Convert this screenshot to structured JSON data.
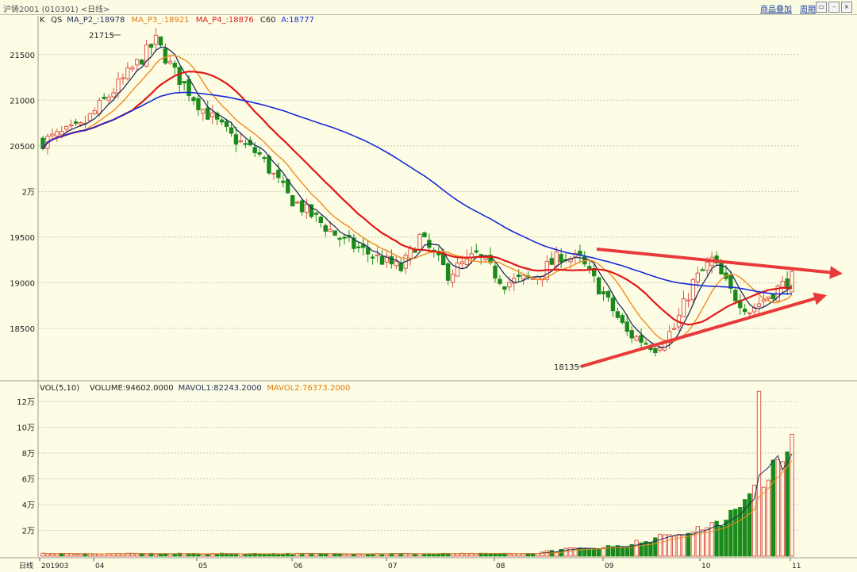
{
  "window": {
    "title": "沪铸2001 (010301) <日线>",
    "links": [
      "商品叠加",
      "周期"
    ]
  },
  "colors": {
    "background": "#fdfde6",
    "up": "#e0554f",
    "down": "#1b8a1b",
    "ma2": "#1e2f5a",
    "ma3": "#f08a1c",
    "ma4": "#e01818",
    "ma60": "#1a28d6",
    "arrow": "#e83a3a"
  },
  "price_panel": {
    "legend": [
      {
        "text": "K",
        "color": "#222222"
      },
      {
        "text": "QS",
        "color": "#222222"
      },
      {
        "text": "MA_P2_:18978",
        "color": "#1e2f5a"
      },
      {
        "text": "MA_P3_:18921",
        "color": "#e07a10"
      },
      {
        "text": "MA_P4_:18876",
        "color": "#e01818"
      },
      {
        "text": "C60",
        "color": "#222222"
      },
      {
        "text": "A:18777",
        "color": "#1a28d6"
      }
    ],
    "y_labels": [
      "21500",
      "21000",
      "20500",
      "2万",
      "19500",
      "19000",
      "18500"
    ],
    "high_label": "21715",
    "low_label": "18135"
  },
  "volume_panel": {
    "legend": [
      {
        "text": "VOL(5,10)",
        "color": "#222222"
      },
      {
        "text": "VOLUME:94602.0000",
        "color": "#222222"
      },
      {
        "text": "MAVOL1:82243.2000",
        "color": "#1e2f5a"
      },
      {
        "text": "MAVOL2:76373.2000",
        "color": "#e07a10"
      }
    ],
    "y_labels": [
      "12万",
      "10万",
      "8万",
      "6万",
      "4万",
      "2万"
    ]
  },
  "x_axis": {
    "period_label": "日线",
    "labels": [
      "201903",
      "04",
      "05",
      "06",
      "07",
      "08",
      "09",
      "10",
      "11"
    ]
  },
  "chart_data": {
    "type": "candlestick",
    "price_range": [
      18100,
      21750
    ],
    "ma_values": {
      "MA_P2": 18978,
      "MA_P3": 18921,
      "MA_P4": 18876,
      "C60": 18777
    },
    "high": 21715,
    "low": 18135,
    "volume_range": [
      0,
      130000
    ],
    "last_volume": 94602,
    "mavol1": 82243.2,
    "mavol2": 76373.2
  }
}
